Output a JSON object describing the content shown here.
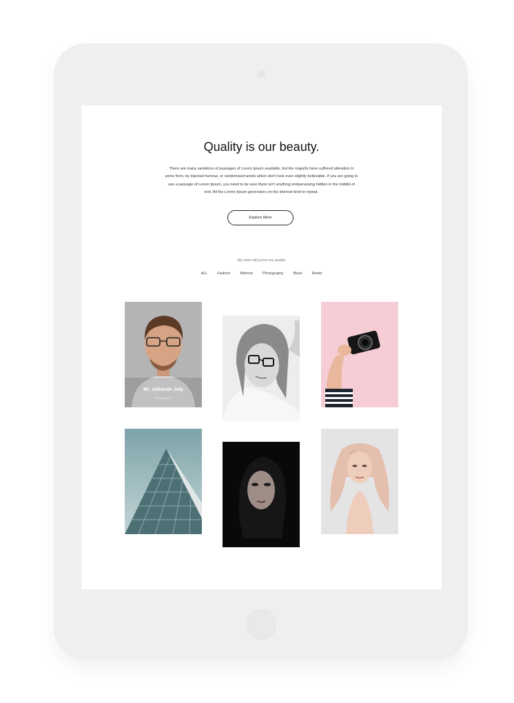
{
  "hero": {
    "title": "Quality is our beauty.",
    "description": "There are many variations of passages of Lorem Ipsum available, but the majority have suffered alteration in some form, by injected humour, or randomised words which don't look even slightly believable. If you are going to use a passage of Lorem Ipsum, you need to be sure there isn't anything embarrassing hidden in the middle of text. All the Lorem Ipsum generators on the Internet tend to repeat.",
    "button_label": "Explore More"
  },
  "portfolio": {
    "tagline": "My work will prove my quality",
    "filters": [
      "ALL",
      "Fashion",
      "Minimal",
      "Photography",
      "Black",
      "Model"
    ],
    "featured": {
      "name": "Mr. Joharuin Joly",
      "role": "Photography"
    }
  }
}
